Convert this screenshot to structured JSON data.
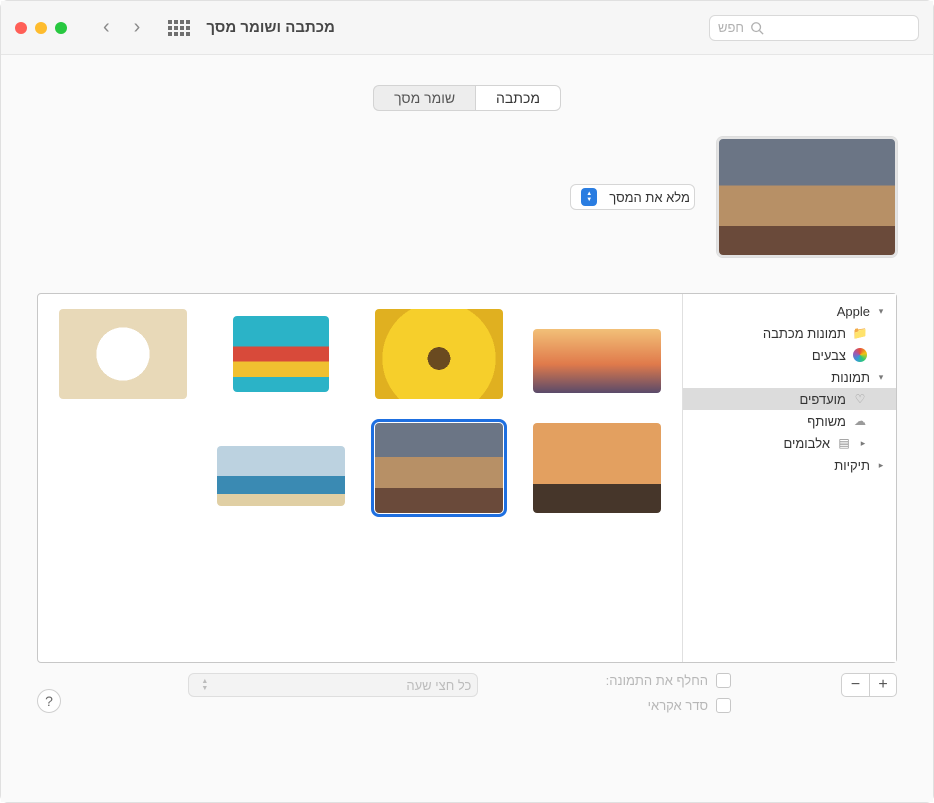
{
  "window": {
    "title": "מכתבה ושומר מסך"
  },
  "search": {
    "placeholder": "חפש"
  },
  "tabs": {
    "desktop": "מכתבה",
    "screensaver": "שומר מסך"
  },
  "fit": {
    "label": "מלא את המסך"
  },
  "sidebar": {
    "apple": "Apple",
    "desktop_pictures": "תמונות מכתבה",
    "colors": "צבעים",
    "photos": "תמונות",
    "favorites": "מועדפים",
    "shared": "משותף",
    "albums": "אלבומים",
    "folders": "תיקיות"
  },
  "footer": {
    "change_picture": "החלף את התמונה:",
    "random_order": "סדר אקראי",
    "interval": "כל חצי שעה"
  },
  "help": "?"
}
